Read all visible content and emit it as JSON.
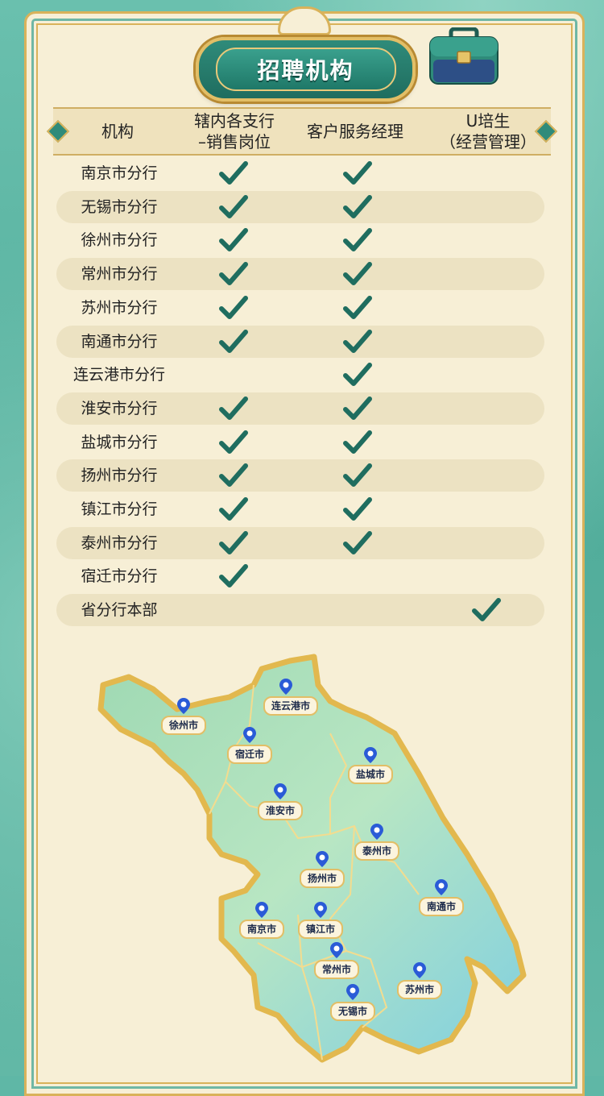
{
  "title": "招聘机构",
  "columns": [
    "机构",
    "辖内各支行\n–销售岗位",
    "客户服务经理",
    "U培生\n（经营管理）"
  ],
  "column_lines": [
    [
      "机构"
    ],
    [
      "辖内各支行",
      "–销售岗位"
    ],
    [
      "客户服务经理"
    ],
    [
      "U培生",
      "（经营管理）"
    ]
  ],
  "rows": [
    {
      "org": "南京市分行",
      "sales": true,
      "csm": true,
      "u": false
    },
    {
      "org": "无锡市分行",
      "sales": true,
      "csm": true,
      "u": false
    },
    {
      "org": "徐州市分行",
      "sales": true,
      "csm": true,
      "u": false
    },
    {
      "org": "常州市分行",
      "sales": true,
      "csm": true,
      "u": false
    },
    {
      "org": "苏州市分行",
      "sales": true,
      "csm": true,
      "u": false
    },
    {
      "org": "南通市分行",
      "sales": true,
      "csm": true,
      "u": false
    },
    {
      "org": "连云港市分行",
      "sales": false,
      "csm": true,
      "u": false
    },
    {
      "org": "淮安市分行",
      "sales": true,
      "csm": true,
      "u": false
    },
    {
      "org": "盐城市分行",
      "sales": true,
      "csm": true,
      "u": false
    },
    {
      "org": "扬州市分行",
      "sales": true,
      "csm": true,
      "u": false
    },
    {
      "org": "镇江市分行",
      "sales": true,
      "csm": true,
      "u": false
    },
    {
      "org": "泰州市分行",
      "sales": true,
      "csm": true,
      "u": false
    },
    {
      "org": "宿迁市分行",
      "sales": true,
      "csm": false,
      "u": false
    },
    {
      "org": "省分行本部",
      "sales": false,
      "csm": false,
      "u": true
    }
  ],
  "map_cities": [
    "徐州市",
    "连云港市",
    "宿迁市",
    "盐城市",
    "淮安市",
    "泰州市",
    "扬州市",
    "南通市",
    "南京市",
    "镇江市",
    "常州市",
    "苏州市",
    "无锡市"
  ],
  "colors": {
    "accent": "#1f6d5f",
    "gold": "#d9b25a",
    "paper": "#f7efd6",
    "check": "#1f6d5f",
    "pin": "#2a5bd7"
  },
  "icons": {
    "check": "check-icon",
    "pin": "map-pin-icon",
    "briefcase": "briefcase-icon"
  }
}
